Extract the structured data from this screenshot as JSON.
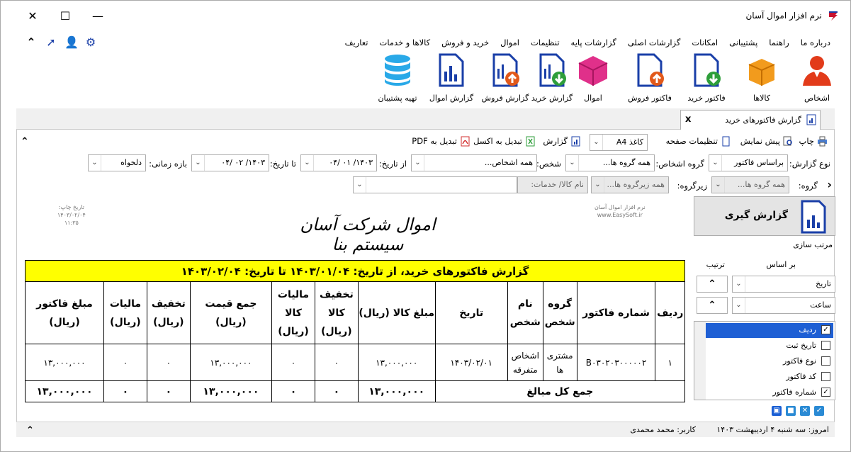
{
  "window": {
    "title": "نرم افزار اموال آسان",
    "minimize": "—",
    "maximize": "☐",
    "close": "✕"
  },
  "menu": [
    "تعاریف",
    "کالاها و خدمات",
    "خرید و فروش",
    "اموال",
    "تنظیمات",
    "گزارشات پایه",
    "گزارشات اصلی",
    "امکانات",
    "پشتیبانی",
    "راهنما",
    "درباره ما"
  ],
  "ribbon": [
    {
      "label": "اشخاص",
      "icon": "person-icon"
    },
    {
      "label": "کالاها",
      "icon": "box-icon"
    },
    {
      "label": "فاکتور خرید",
      "icon": "purchase-invoice-icon"
    },
    {
      "label": "فاکتور فروش",
      "icon": "sales-invoice-icon"
    },
    {
      "label": "اموال",
      "icon": "assets-icon"
    },
    {
      "label": "گزارش خرید",
      "icon": "purchase-report-icon"
    },
    {
      "label": "گزارش فروش",
      "icon": "sales-report-icon"
    },
    {
      "label": "گزارش اموال",
      "icon": "assets-report-icon"
    },
    {
      "label": "تهیه پشتیبان",
      "icon": "backup-database-icon"
    }
  ],
  "tab": {
    "label": "گزارش فاکتورهای خرید",
    "close": "x"
  },
  "toolbar": {
    "print": "چاپ",
    "preview": "پیش نمایش",
    "page_settings": "تنظیمات صفحه",
    "paper": "کاغذ A4",
    "report": "گزارش",
    "excel": "تبدیل به اکسل",
    "pdf": "تبدیل به PDF"
  },
  "filters": {
    "report_type_label": "نوع گزارش:",
    "report_type": "براساس فاکتور",
    "person_group_label": "گروه اشخاص:",
    "person_group": "همه گروه ها...",
    "person_label": "شخص:",
    "person": "همه اشخاص...",
    "from_date_label": "از تاریخ:",
    "from_date": "۱۴۰۳/ ۰۱ /۰۴",
    "to_date_label": "تا تاریخ:",
    "to_date": "۱۴۰۳/ ۰۲ /۰۴",
    "period_label": "بازه زمانی:",
    "period": "دلخواه",
    "group_label": "گروه:",
    "group": "همه گروه ها...",
    "subgroup_label": "زیرگروه:",
    "subgroup": "همه زیرگروه ها...",
    "item": "نام کالا/ خدمات:"
  },
  "report": {
    "app_name": "نرم افزار اموال آسان",
    "site": "www.EasySoft.ir",
    "print_date_label": "تاریخ چاپ:",
    "print_date": "۱۴۰۳/۰۲/۰۴",
    "print_time": "۱۱:۳۵",
    "company": "اموال شرکت آسان سیستم بنا",
    "heading": "گزارش فاکتورهای خرید، از تاریخ: ۱۴۰۳/۰۱/۰۴ تا تاریخ: ۱۴۰۳/۰۲/۰۴",
    "columns": [
      "ردیف",
      "شماره فاکتور",
      "گروه شخص",
      "نام شخص",
      "تاریخ",
      "مبلغ کالا (ریال)",
      "تخفیف کالا (ریال)",
      "مالیات کالا (ریال)",
      "جمع قیمت (ریال)",
      "تخفیف (ریال)",
      "مالیات (ریال)",
      "مبلغ فاکتور (ریال)"
    ],
    "rows": [
      [
        "۱",
        "B۰۳۰۲۰۳۰۰۰۰۰۲",
        "مشتری ها",
        "اشخاص متفرقه",
        "۱۴۰۳/۰۲/۰۱",
        "۱۳,۰۰۰,۰۰۰",
        "۰",
        "۰",
        "۱۳,۰۰۰,۰۰۰",
        "۰",
        "۰",
        "۱۳,۰۰۰,۰۰۰"
      ]
    ],
    "total_label": "جمع کل مبالغ",
    "totals": [
      "۱۳,۰۰۰,۰۰۰",
      "۰",
      "۰",
      "۱۳,۰۰۰,۰۰۰",
      "۰",
      "۰",
      "۱۳,۰۰۰,۰۰۰"
    ]
  },
  "side": {
    "report_button": "گزارش گیری",
    "sort_title": "مرتب سازی",
    "based_on": "بر اساس",
    "order": "ترتیب",
    "sort1": "تاریخ",
    "sort2": "ساعت",
    "fields": [
      {
        "label": "ردیف",
        "checked": true,
        "selected": true
      },
      {
        "label": "تاریخ ثبت",
        "checked": false,
        "selected": false
      },
      {
        "label": "نوع فاکتور",
        "checked": false,
        "selected": false
      },
      {
        "label": "کد فاکتور",
        "checked": false,
        "selected": false
      },
      {
        "label": "شماره فاکتور",
        "checked": true,
        "selected": false
      }
    ]
  },
  "status": {
    "today": "امروز: سه شنبه ۴ اردیبهشت ۱۴۰۳",
    "user": "کاربر: محمد محمدی"
  },
  "colors": {
    "accent": "#1a3fa8",
    "yellow": "#ffff00",
    "selection": "#1e5fd4",
    "orange": "#f29b1d",
    "red": "#e23b1a",
    "pink": "#e0308a",
    "green": "#2e9e3a"
  }
}
